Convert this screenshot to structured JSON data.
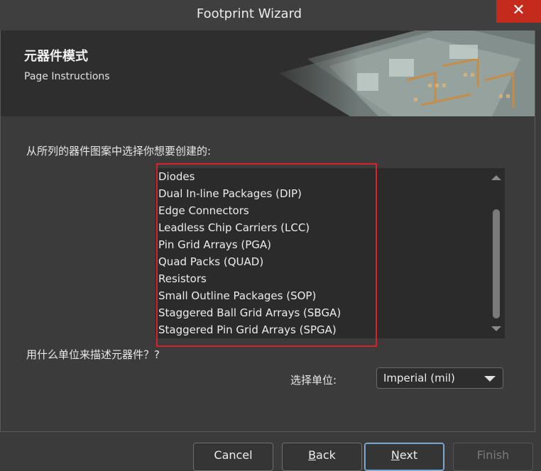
{
  "window": {
    "title": "Footprint Wizard",
    "close_glyph": "✕"
  },
  "banner": {
    "title": "元器件模式",
    "subtitle": "Page Instructions"
  },
  "content": {
    "prompt_pattern": "从所列的器件图案中选择你想要创建的:",
    "patterns": [
      "Diodes",
      "Dual In-line Packages (DIP)",
      "Edge Connectors",
      "Leadless Chip Carriers (LCC)",
      "Pin Grid Arrays (PGA)",
      "Quad Packs (QUAD)",
      "Resistors",
      "Small Outline Packages (SOP)",
      "Staggered Ball Grid Arrays (SBGA)",
      "Staggered Pin Grid Arrays (SPGA)"
    ],
    "prompt_units": "用什么单位来描述元器件？?",
    "unit_label": "选择单位:",
    "unit_value": "Imperial (mil)"
  },
  "buttons": {
    "cancel": "Cancel",
    "back_mnemonic": "B",
    "back_rest": "ack",
    "next_mnemonic": "N",
    "next_rest": "ext",
    "finish": "Finish"
  },
  "colors": {
    "highlight_border": "#d9202b",
    "close_button": "#c42b1c"
  }
}
